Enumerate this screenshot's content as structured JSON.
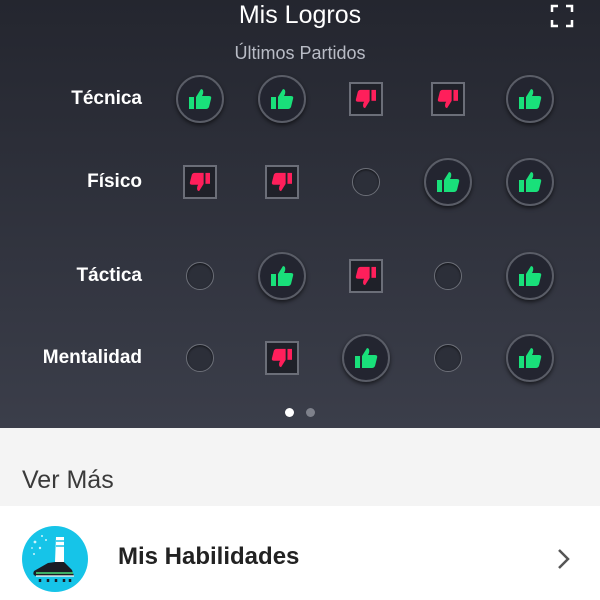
{
  "header": {
    "title": "Mis Logros",
    "subtitle": "Últimos Partidos",
    "expand_icon": "fullscreen-icon"
  },
  "rows": [
    {
      "label": "Técnica",
      "results": [
        "up",
        "up",
        "down",
        "down",
        "up"
      ]
    },
    {
      "label": "Físico",
      "results": [
        "down",
        "down",
        "empty",
        "up",
        "up"
      ]
    },
    {
      "label": "Táctica",
      "results": [
        "empty",
        "up",
        "down",
        "empty",
        "up"
      ]
    },
    {
      "label": "Mentalidad",
      "results": [
        "empty",
        "down",
        "up",
        "empty",
        "up"
      ]
    }
  ],
  "pagination": {
    "pages": 2,
    "current": 1
  },
  "colors": {
    "up": "#19e07a",
    "down": "#ff1f5b",
    "accent": "#16c4e8"
  },
  "ver_mas": "Ver Más",
  "skills": {
    "label": "Mis Habilidades",
    "icon": "soccer-cleat-icon",
    "chevron": "chevron-right-icon"
  }
}
